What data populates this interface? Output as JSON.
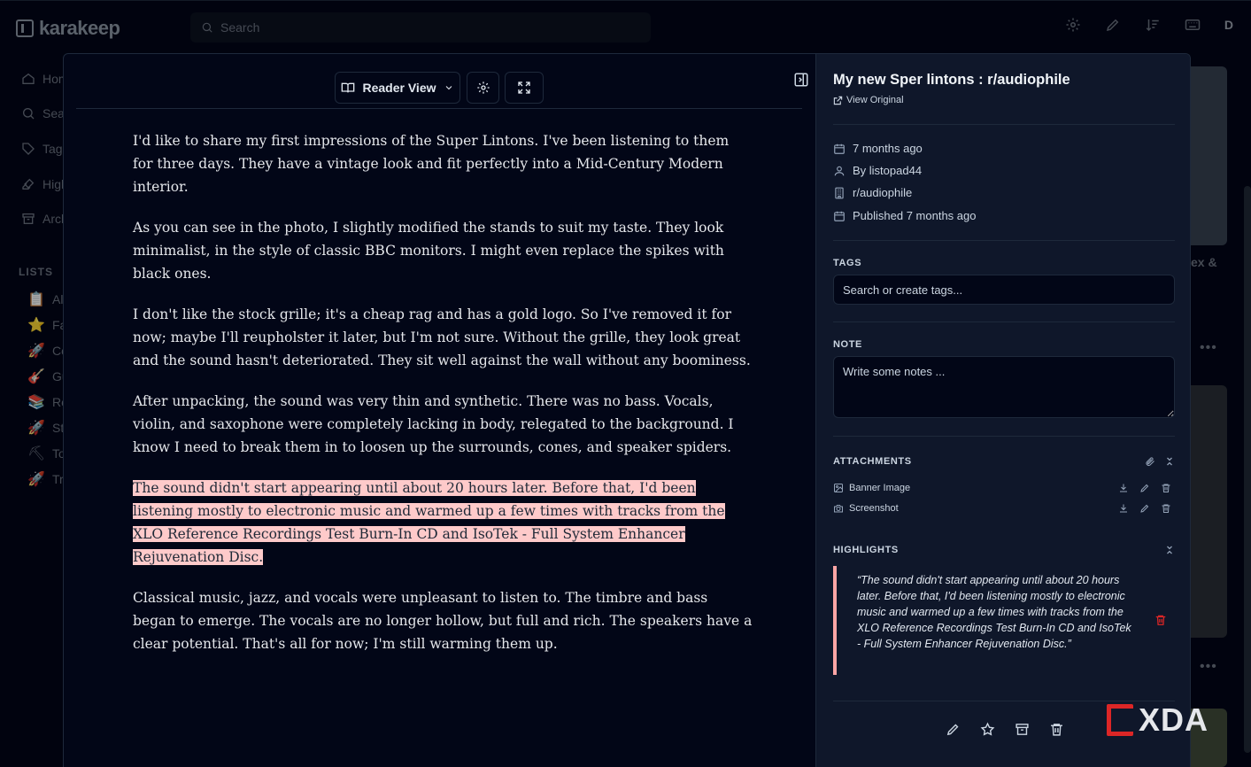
{
  "app": {
    "name": "karakeep"
  },
  "topbar": {
    "search_placeholder": "Search",
    "avatar_letter": "D"
  },
  "sidebar": {
    "items": [
      {
        "label": "Home",
        "icon": "home-icon"
      },
      {
        "label": "Search",
        "icon": "search-icon"
      },
      {
        "label": "Tags",
        "icon": "tag-icon"
      },
      {
        "label": "Highlights",
        "icon": "highlighter-icon"
      },
      {
        "label": "Archive",
        "icon": "archive-icon"
      }
    ],
    "lists_label": "LISTS",
    "lists": [
      {
        "emoji": "📋",
        "label": "All"
      },
      {
        "emoji": "⭐",
        "label": "Favourites"
      },
      {
        "emoji": "🚀",
        "label": "Co"
      },
      {
        "emoji": "🎸",
        "label": "Gu"
      },
      {
        "emoji": "📚",
        "label": "Re"
      },
      {
        "emoji": "🚀",
        "label": "St"
      },
      {
        "emoji": "⛏",
        "label": "To"
      },
      {
        "emoji": "🚀",
        "label": "Tr"
      }
    ]
  },
  "background": {
    "card_text": "ex &",
    "more_dots": "•••"
  },
  "reader": {
    "view_mode": "Reader View",
    "paragraphs": [
      "I'd like to share my first impressions of the Super Lintons. I've been listening to them for three days. They have a vintage look and fit perfectly into a Mid-Century Modern interior.",
      "As you can see in the photo, I slightly modified the stands to suit my taste. They look minimalist, in the style of classic BBC monitors. I might even replace the spikes with black ones.",
      "I don't like the stock grille; it's a cheap rag and has a gold logo. So I've removed it for now; maybe I'll reupholster it later, but I'm not sure. Without the grille, they look great and the sound hasn't deteriorated. They sit well against the wall without any boominess.",
      "After unpacking, the sound was very thin and synthetic. There was no bass. Vocals, violin, and saxophone were completely lacking in body, relegated to the background. I know I need to break them in to loosen up the surrounds, cones, and speaker spiders.",
      "The sound didn't start appearing until about 20 hours later. Before that, I'd been listening mostly to electronic music and warmed up a few times with tracks from the XLO Reference Recordings Test Burn-In CD and IsoTek - Full System Enhancer Rejuvenation Disc.",
      "Classical music, jazz, and vocals were unpleasant to listen to. The timbre and bass began to emerge. The vocals are no longer hollow, but full and rich. The speakers have a clear potential. That's all for now; I'm still warming them up."
    ]
  },
  "details": {
    "title": "My new Sper lintons : r/audiophile",
    "view_original": "View Original",
    "meta": {
      "saved": "7 months ago",
      "author": "By listopad44",
      "publisher": "r/audiophile",
      "published": "Published 7 months ago"
    },
    "tags_label": "TAGS",
    "tags_placeholder": "Search or create tags...",
    "note_label": "NOTE",
    "note_placeholder": "Write some notes ...",
    "attachments_label": "ATTACHMENTS",
    "attachments": [
      {
        "label": "Banner Image",
        "icon": "image-icon"
      },
      {
        "label": "Screenshot",
        "icon": "camera-icon"
      }
    ],
    "highlights_label": "HIGHLIGHTS",
    "highlight_quote": "“The sound didn't start appearing until about 20 hours later. Before that, I'd been listening mostly to electronic music and warmed up a few times with tracks from the XLO Reference Recordings Test Burn-In CD and IsoTek - Full System Enhancer Rejuvenation Disc.”"
  },
  "watermark": {
    "text": "XDA"
  },
  "colors": {
    "background": "#020617",
    "panel": "#0f172a",
    "border": "#1e293b",
    "highlight": "#fecaca",
    "highlight_bar": "#fca5a5",
    "danger": "#dc2626"
  }
}
